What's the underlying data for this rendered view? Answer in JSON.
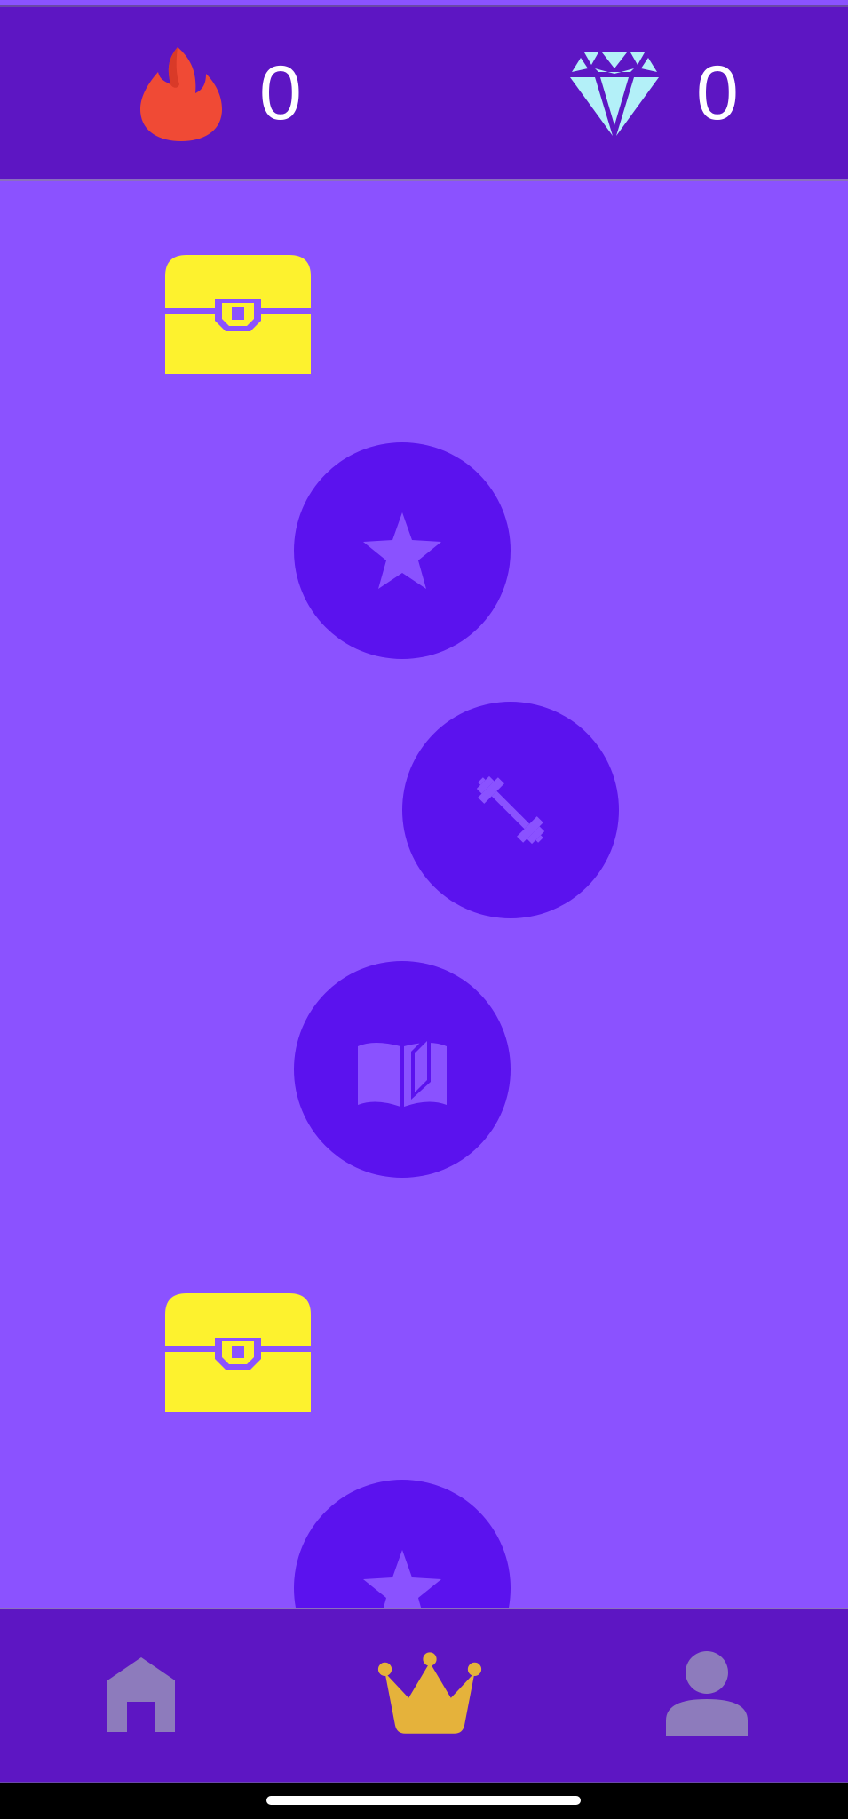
{
  "header": {
    "streak": {
      "icon": "flame-icon",
      "value": "0",
      "color": "#f04a35"
    },
    "gems": {
      "icon": "diamond-icon",
      "value": "0",
      "color": "#b3f0f8"
    }
  },
  "path": {
    "items": [
      {
        "kind": "chest",
        "icon": "treasure-chest-icon",
        "color": "#fdf22e"
      },
      {
        "kind": "lesson",
        "icon": "star-icon"
      },
      {
        "kind": "lesson",
        "icon": "dumbbell-icon"
      },
      {
        "kind": "lesson",
        "icon": "book-icon"
      },
      {
        "kind": "chest",
        "icon": "treasure-chest-icon",
        "color": "#fdf22e"
      },
      {
        "kind": "lesson",
        "icon": "star-icon"
      }
    ]
  },
  "bottom_nav": {
    "items": [
      {
        "id": "home",
        "icon": "home-icon",
        "active": false
      },
      {
        "id": "leaderboard",
        "icon": "crown-icon",
        "active": true
      },
      {
        "id": "profile",
        "icon": "person-icon",
        "active": false
      }
    ]
  },
  "colors": {
    "background": "#8b52ff",
    "bar": "#5d16c3",
    "node": "#5b12ee",
    "node_icon": "#8a52ff",
    "nav_inactive": "#8d7bbc",
    "nav_active": "#e5b23b"
  }
}
